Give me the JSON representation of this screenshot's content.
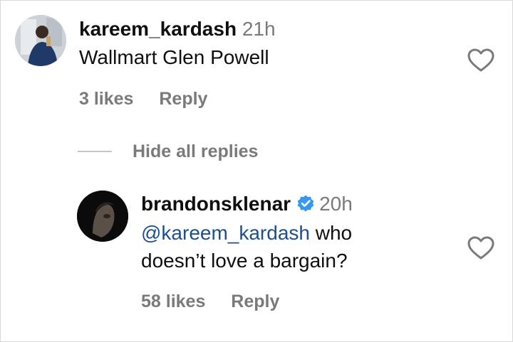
{
  "comment": {
    "username": "kareem_kardash",
    "time": "21h",
    "text": "Wallmart Glen Powell",
    "likes": "3 likes",
    "reply_label": "Reply",
    "liked": false
  },
  "replies_toggle": {
    "label": "Hide all replies"
  },
  "reply": {
    "username": "brandonsklenar",
    "verified": true,
    "time": "20h",
    "mention": "@kareem_kardash",
    "text_line1_rest": " who",
    "text_line2": "doesn’t love a bargain?",
    "likes": "58 likes",
    "reply_label": "Reply",
    "liked": false
  },
  "colors": {
    "username": "#0f0f0f",
    "secondary": "#7a7a7a",
    "mention": "#1c4f8f",
    "verified_badge": "#3897f0",
    "divider": "#c7c7c7"
  },
  "icons": {
    "like": "heart-outline-icon",
    "verified": "verified-badge-icon"
  }
}
